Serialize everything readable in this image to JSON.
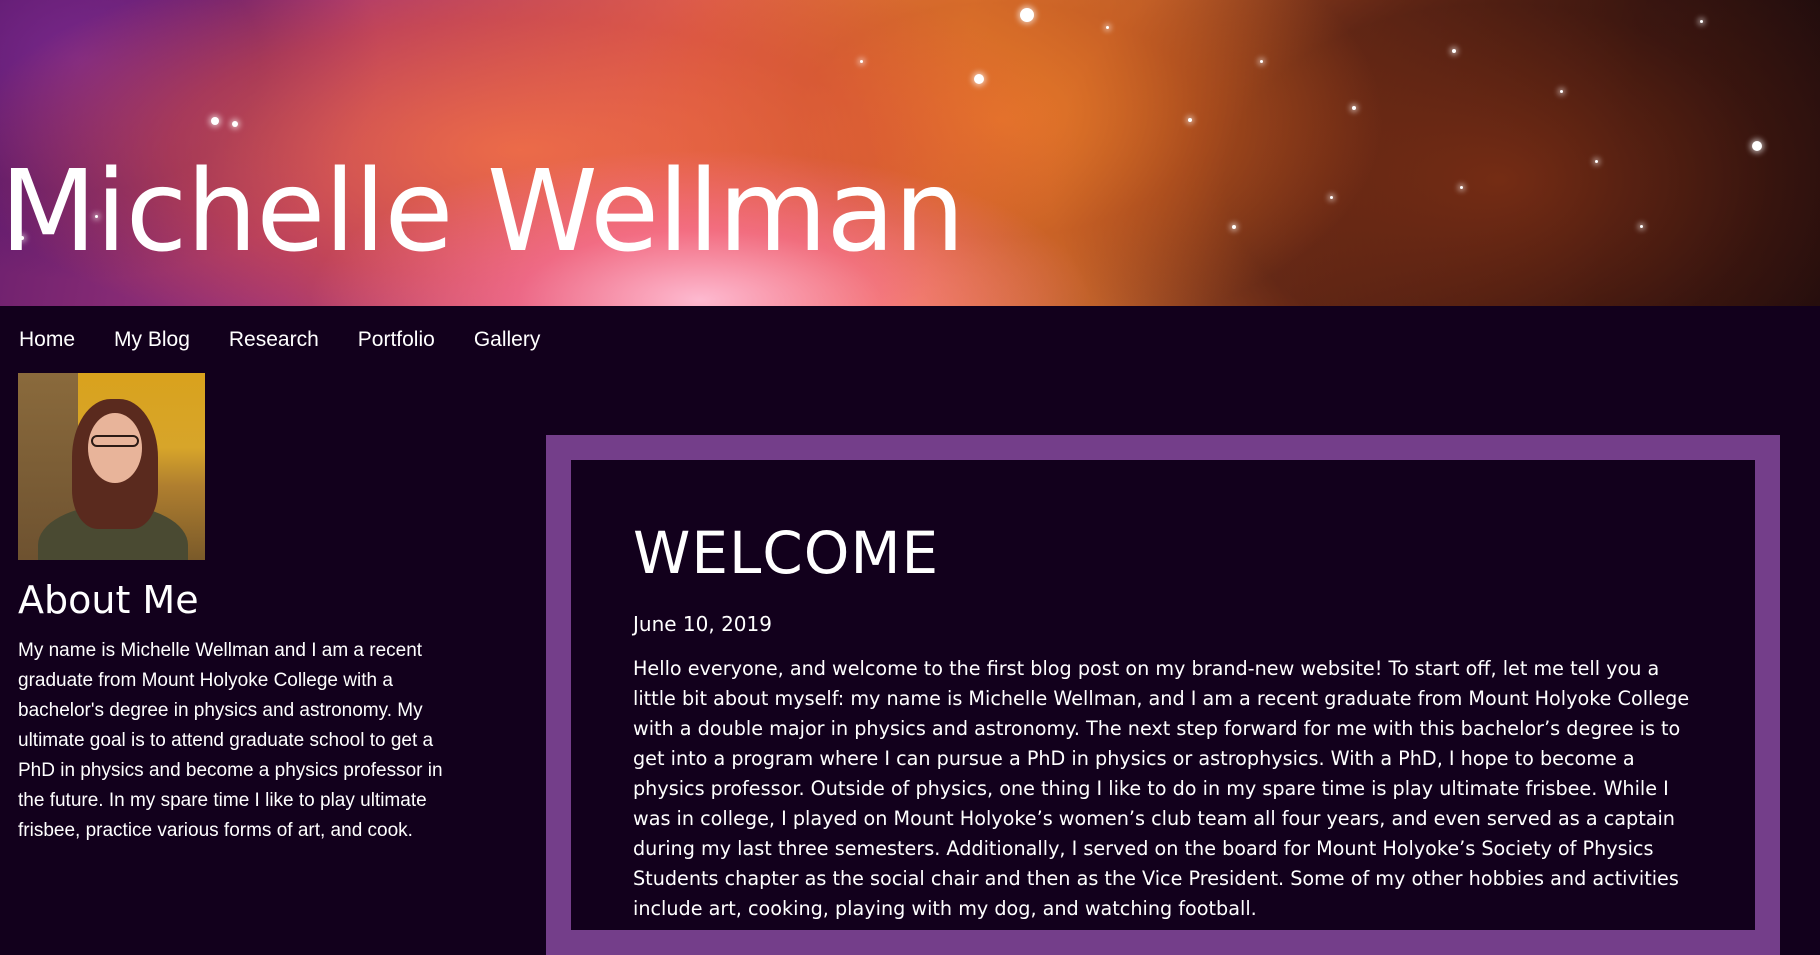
{
  "site": {
    "title": "Michelle Wellman"
  },
  "nav": {
    "items": [
      "Home",
      "My Blog",
      "Research",
      "Portfolio",
      "Gallery"
    ]
  },
  "sidebar": {
    "about_heading": "About Me",
    "about_text": "My name is Michelle Wellman and I am a recent graduate from Mount Holyoke College with a bachelor's degree in physics and astronomy. My ultimate goal is to attend graduate school to get a PhD in physics and become a physics professor in the future. In my spare time I like to play ultimate frisbee, practice various forms of art, and cook."
  },
  "post": {
    "title": "WELCOME",
    "date": "June 10, 2019",
    "body": "Hello everyone, and welcome to the first blog post on my brand-new website! To start off, let me tell you a little bit about myself: my name is Michelle Wellman, and I am a recent graduate from Mount Holyoke College with a double major in physics and astronomy. The next step forward for me with this bachelor’s degree is to get into a program where I can pursue a PhD in physics or astrophysics. With a PhD, I hope to become a physics professor. Outside of physics, one thing I like to do in my spare time is play ultimate frisbee. While I was in college, I played on Mount Holyoke’s women’s club team all four years, and even served as a captain during my last three semesters. Additionally, I served on the board for Mount Holyoke’s Society of Physics Students chapter as the social chair and then as the Vice President. Some of my other hobbies and activities include art, cooking, playing with my dog, and watching football."
  },
  "colors": {
    "background": "#12001c",
    "post_border": "#743e8a",
    "text": "#ffffff"
  },
  "icons": {
    "avatar": "profile-photo"
  }
}
